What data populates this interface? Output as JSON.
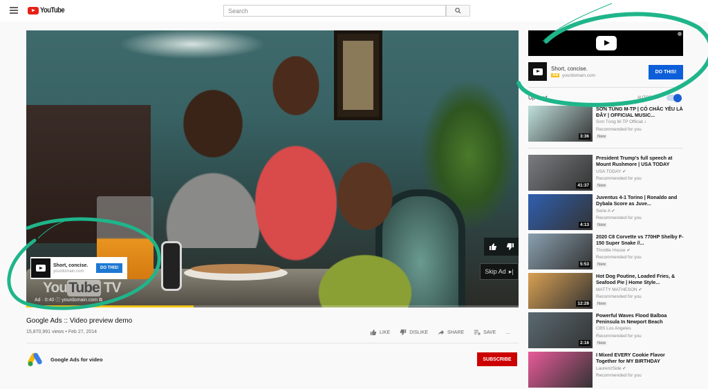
{
  "header": {
    "logo_text": "YouTube",
    "search_placeholder": "Search"
  },
  "player": {
    "ad_overlay": {
      "title": "Short, concise.",
      "url": "yourdomain.com",
      "button": "DO THIS!"
    },
    "watermark_left": "You",
    "watermark_tube": "Tube",
    "watermark_right": "TV",
    "ad_info": "Ad · 0:40 ⓘ yourdomain.com ⧉",
    "skip_label": "Skip Ad",
    "progress_percent": 34,
    "colors": {
      "progress": "#f4c412"
    }
  },
  "video": {
    "title": "Google Ads :: Video preview demo",
    "meta": "15,870,991 views • Feb 27, 2014",
    "actions": [
      "LIKE",
      "DISLIKE",
      "SHARE",
      "SAVE",
      "..."
    ],
    "channel_name": "Google Ads for video",
    "subscribe_label": "SUBSCRIBE"
  },
  "sidebar": {
    "companion_ad": {
      "title": "Short, concise.",
      "badge": "Ad",
      "url": "yourdomain.com",
      "button": "DO THIS!"
    },
    "up_next_label": "Up next",
    "autoplay_label": "AUTOPLAY",
    "autoplay_on": true,
    "recommendations": [
      {
        "title": "SƠN TÙNG M-TP | CÓ CHẮC YÊU LÀ ĐÂY | OFFICIAL MUSIC...",
        "channel": "Sơn Tùng M-TP Official ♪",
        "reason": "Recommended for you",
        "badge": "New",
        "duration": "3:36",
        "thumb_color": "#bfe0dc"
      },
      {
        "title": "President Trump's full speech at Mount Rushmore | USA TODAY",
        "channel": "USA TODAY ✔",
        "reason": "Recommended for you",
        "badge": "New",
        "duration": "41:37",
        "thumb_color": "#7a7c80"
      },
      {
        "title": "Juventus 4-1 Torino | Ronaldo and Dybala Score as Juve...",
        "channel": "Serie A ✔",
        "reason": "Recommended for you",
        "badge": "New",
        "duration": "4:13",
        "thumb_color": "#2f5fb0"
      },
      {
        "title": "2020 C8 Corvette vs 770HP Shelby F-150 Super Snake //...",
        "channel": "Throttle House ✔",
        "reason": "Recommended for you",
        "badge": "New",
        "duration": "5:53",
        "thumb_color": "#8aa0b0"
      },
      {
        "title": "Hot Dog Poutine, Loaded Fries, & Seafood Pie | Home Style...",
        "channel": "MATTY MATHESON ✔",
        "reason": "Recommended for you",
        "badge": "New",
        "duration": "12:28",
        "thumb_color": "#d9a052"
      },
      {
        "title": "Powerful Waves Flood Balboa Peninsula In Newport Beach",
        "channel": "CBS Los Angeles",
        "reason": "Recommended for you",
        "badge": "New",
        "duration": "2:16",
        "thumb_color": "#5a6a72"
      },
      {
        "title": "I Mixed EVERY Cookie Flavor Together for MY BIRTHDAY",
        "channel": "LaurenzSide ✔",
        "reason": "Recommended for you",
        "badge": "",
        "duration": "",
        "thumb_color": "#e85a9a"
      }
    ]
  },
  "annotation_color": "#1fb58a"
}
